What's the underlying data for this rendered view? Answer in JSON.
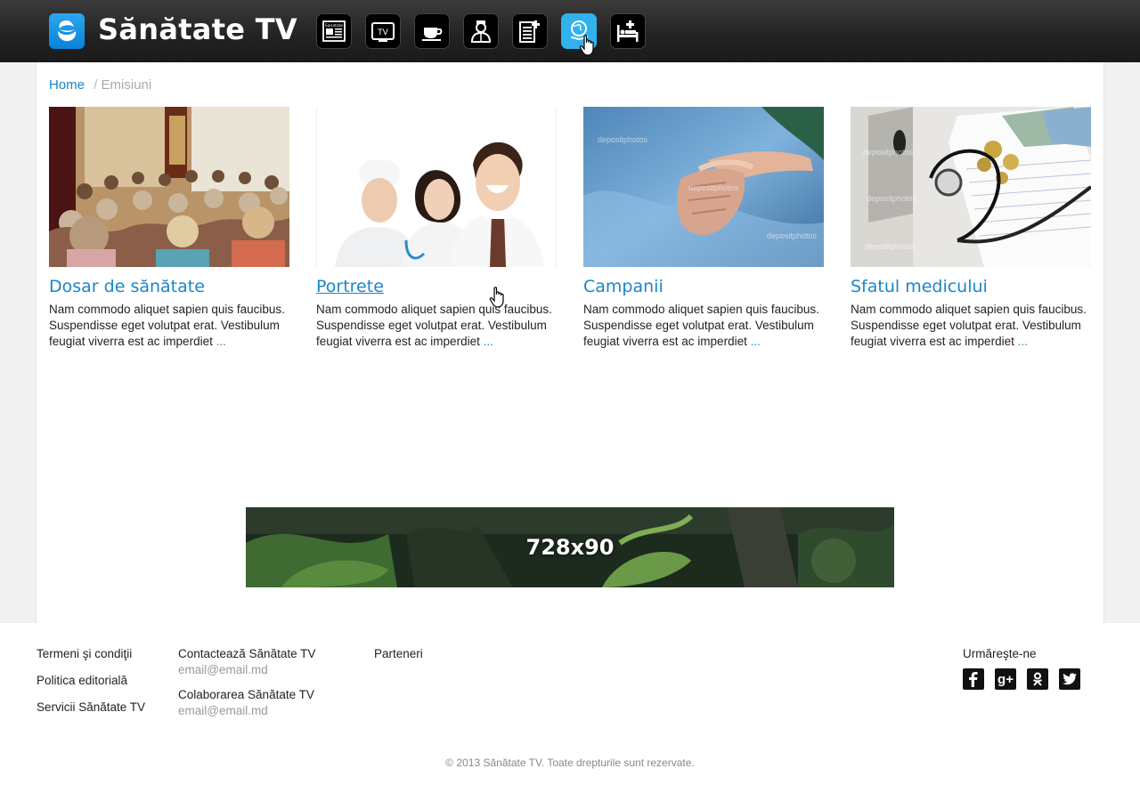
{
  "header": {
    "brand": "Sănătate TV",
    "nav_icons": [
      "newspaper-icon",
      "tv-icon",
      "coffee-cup-icon",
      "doctor-icon",
      "document-plus-icon",
      "globe-hand-icon",
      "hospital-bed-icon"
    ],
    "nav_icon_labels": {
      "newspaper": "Sanatate",
      "tv": "TV"
    },
    "active_nav_index": 5,
    "colors": {
      "bar": "#222222",
      "active": "#31b2ec",
      "logo": "#0a82d8"
    }
  },
  "breadcrumb": {
    "home": "Home",
    "separator": "/",
    "current": "Emisiuni"
  },
  "cards": [
    {
      "title": "Dosar de sănătate",
      "description": "Nam commodo aliquet sapien quis faucibus. Suspendisse eget volutpat erat. Vestibulum feugiat viverra est ac imperdiet",
      "more": "...",
      "image": "conference-audience-photo"
    },
    {
      "title": "Portrete",
      "description": "Nam commodo aliquet sapien quis faucibus. Suspendisse eget volutpat erat. Vestibulum feugiat viverra est ac imperdiet",
      "more": "...",
      "image": "medical-staff-photo"
    },
    {
      "title": "Campanii",
      "description": "Nam commodo aliquet sapien quis faucibus. Suspendisse eget volutpat erat. Vestibulum feugiat viverra est ac imperdiet",
      "more": "...",
      "image": "holding-hands-photo",
      "watermark": "depositphotos"
    },
    {
      "title": "Sfatul medicului",
      "description": "Nam commodo aliquet sapien quis faucibus. Suspendisse eget volutpat erat. Vestibulum feugiat viverra est ac imperdiet",
      "more": "...",
      "image": "stethoscope-money-photo",
      "watermark": "depositphotos"
    }
  ],
  "ad": {
    "label": "728x90"
  },
  "footer": {
    "links": [
      "Termeni şi condiţii",
      "Politica editorială",
      "Servicii Sănătate TV"
    ],
    "contacts": [
      {
        "label": "Contactează Sănătate TV",
        "email": "email@email.md"
      },
      {
        "label": "Colaborarea Sănătate TV",
        "email": "email@email.md"
      }
    ],
    "partners": "Parteneri",
    "follow": {
      "label": "Urmăreşte-ne",
      "icons": [
        "facebook-icon",
        "google-plus-icon",
        "odnoklassniki-icon",
        "twitter-icon"
      ],
      "google_plus_text": "g+"
    },
    "copyright": "© 2013 Sănătate TV. Toate drepturile sunt rezervate."
  }
}
